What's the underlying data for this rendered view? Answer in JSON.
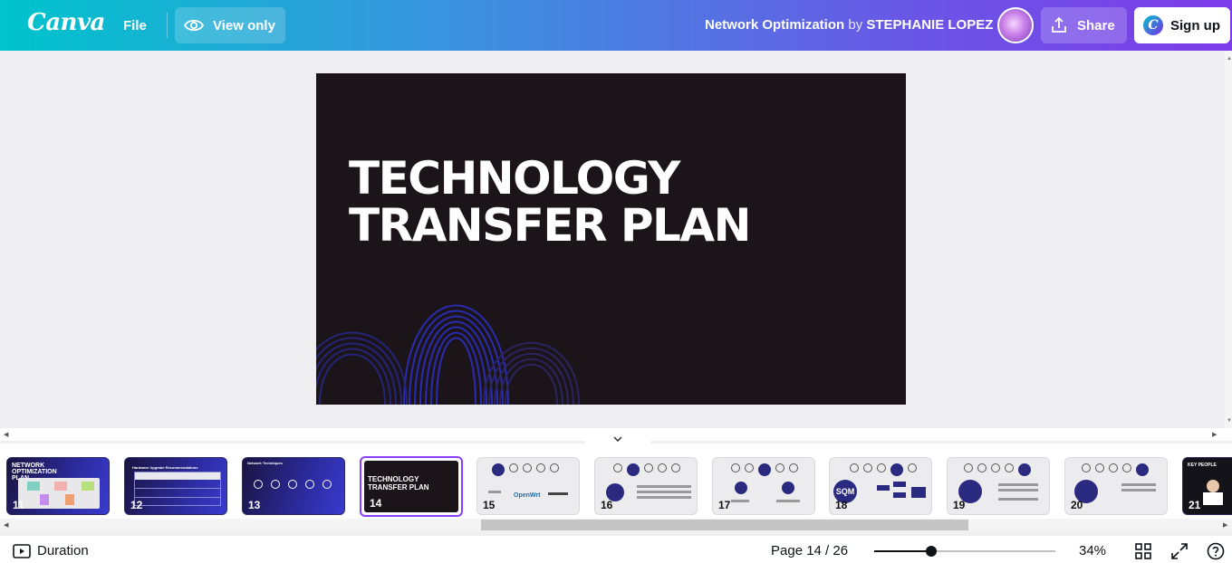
{
  "header": {
    "logo": "Canva",
    "file_label": "File",
    "view_only_label": "View only",
    "doc_title": "Network Optimization",
    "by_text": "by",
    "author": "STEPHANIE LOPEZ",
    "share_label": "Share",
    "signup_label": "Sign up",
    "signup_badge": "C"
  },
  "slide": {
    "title_line1": "TECHNOLOGY",
    "title_line2": "TRANSFER PLAN",
    "background": "#1b1519",
    "accent": "#2b2bb0"
  },
  "filmstrip": {
    "thumbs": [
      {
        "num": "11",
        "title": "NETWORK OPTIMIZATION PLAN",
        "style": "dark"
      },
      {
        "num": "12",
        "title": "Hardware Upgrade Recommendations",
        "style": "dark"
      },
      {
        "num": "13",
        "title": "Network Techniques",
        "style": "dark"
      },
      {
        "num": "14",
        "title": "TECHNOLOGY TRANSFER PLAN",
        "style": "active"
      },
      {
        "num": "15",
        "title": "OpenWrt",
        "style": "light"
      },
      {
        "num": "16",
        "title": "",
        "style": "light"
      },
      {
        "num": "17",
        "title": "",
        "style": "light"
      },
      {
        "num": "18",
        "title": "SQM",
        "style": "light"
      },
      {
        "num": "19",
        "title": "",
        "style": "light"
      },
      {
        "num": "20",
        "title": "",
        "style": "light"
      },
      {
        "num": "21",
        "title": "KEY PEOPLE",
        "style": "dark"
      }
    ]
  },
  "footer": {
    "duration_label": "Duration",
    "page_indicator": "Page 14 / 26",
    "zoom": "34%",
    "zoom_fraction": 0.34
  },
  "icons": [
    "eye-icon",
    "share-icon",
    "play-icon",
    "grid-view-icon",
    "fullscreen-icon",
    "help-icon",
    "chevron-down-icon"
  ]
}
